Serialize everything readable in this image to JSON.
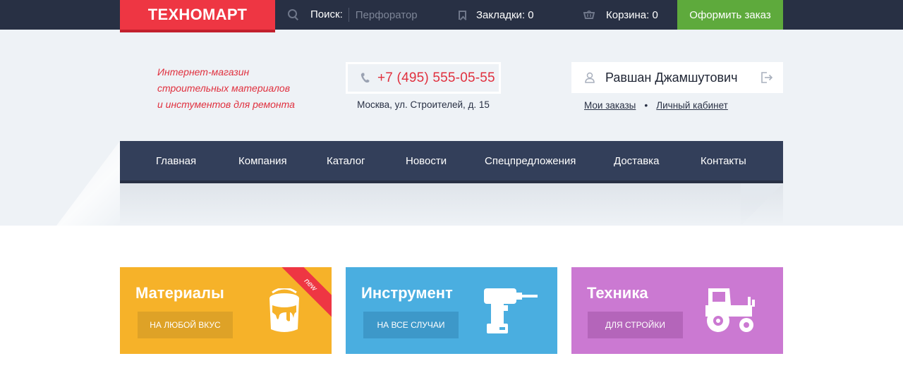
{
  "topbar": {
    "logo": "ТЕХНОМАРТ",
    "search_label": "Поиск:",
    "search_placeholder": "Перфоратор",
    "bookmarks": "Закладки: 0",
    "cart": "Корзина: 0",
    "order_button": "Оформить заказ"
  },
  "header": {
    "slogan": [
      "Интернет-магазин",
      "строительных материалов",
      "и инстументов для ремонта"
    ],
    "phone": "+7 (495) 555-05-55",
    "address": "Москва, ул. Строителей, д. 15",
    "user_name": "Равшан Джамшутович",
    "links": {
      "orders": "Мои заказы",
      "separator": "•",
      "cabinet": "Личный кабинет"
    }
  },
  "nav": {
    "items": [
      "Главная",
      "Компания",
      "Каталог",
      "Новости",
      "Спецпредложения",
      "Доставка",
      "Контакты"
    ]
  },
  "cards": [
    {
      "title": "Материалы",
      "button": "на любой вкус",
      "badge": "new",
      "color": "#f6b229",
      "button_color": "#dea227",
      "icon": "paint-bucket-icon"
    },
    {
      "title": "Инструмент",
      "button": "на все случаи",
      "color": "#4aaee0",
      "button_color": "#3d98c9",
      "icon": "drill-icon"
    },
    {
      "title": "Техника",
      "button": "для стройки",
      "color": "#cb79d2",
      "button_color": "#b465ba",
      "icon": "tractor-icon"
    }
  ],
  "colors": {
    "topbar": "#283044",
    "accent_red": "#ee3643",
    "green": "#5eaa3c",
    "nav": "#333f5a",
    "header_bg": "#eef2f6"
  }
}
